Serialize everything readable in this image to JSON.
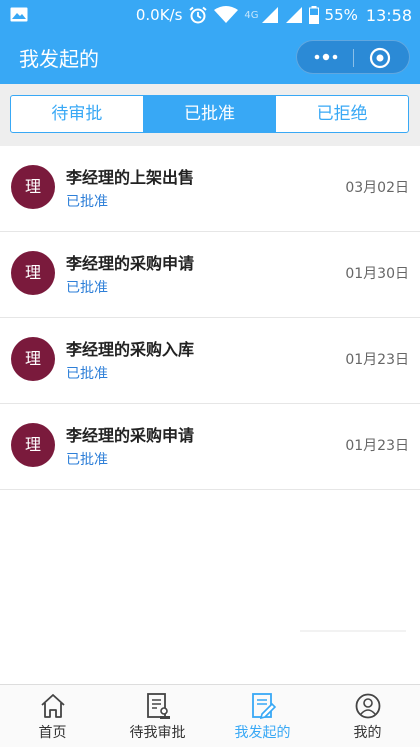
{
  "statusbar": {
    "speed": "0.0K/s",
    "network": "4G",
    "battery": "55%",
    "time": "13:58"
  },
  "navbar": {
    "title": "我发起的"
  },
  "tabs": [
    {
      "label": "待审批",
      "active": false
    },
    {
      "label": "已批准",
      "active": true
    },
    {
      "label": "已拒绝",
      "active": false
    }
  ],
  "list": [
    {
      "avatar": "理",
      "title": "李经理的上架出售",
      "status": "已批准",
      "date": "03月02日"
    },
    {
      "avatar": "理",
      "title": "李经理的采购申请",
      "status": "已批准",
      "date": "01月30日"
    },
    {
      "avatar": "理",
      "title": "李经理的采购入库",
      "status": "已批准",
      "date": "01月23日"
    },
    {
      "avatar": "理",
      "title": "李经理的采购申请",
      "status": "已批准",
      "date": "01月23日"
    }
  ],
  "tabbar": [
    {
      "label": "首页",
      "icon": "home-icon",
      "active": false
    },
    {
      "label": "待我审批",
      "icon": "approval-document-icon",
      "active": false
    },
    {
      "label": "我发起的",
      "icon": "initiated-document-icon",
      "active": true
    },
    {
      "label": "我的",
      "icon": "user-icon",
      "active": false
    }
  ],
  "colors": {
    "primary": "#38a8f5",
    "avatar": "#7a1a3c",
    "status": "#2e7fd8"
  }
}
